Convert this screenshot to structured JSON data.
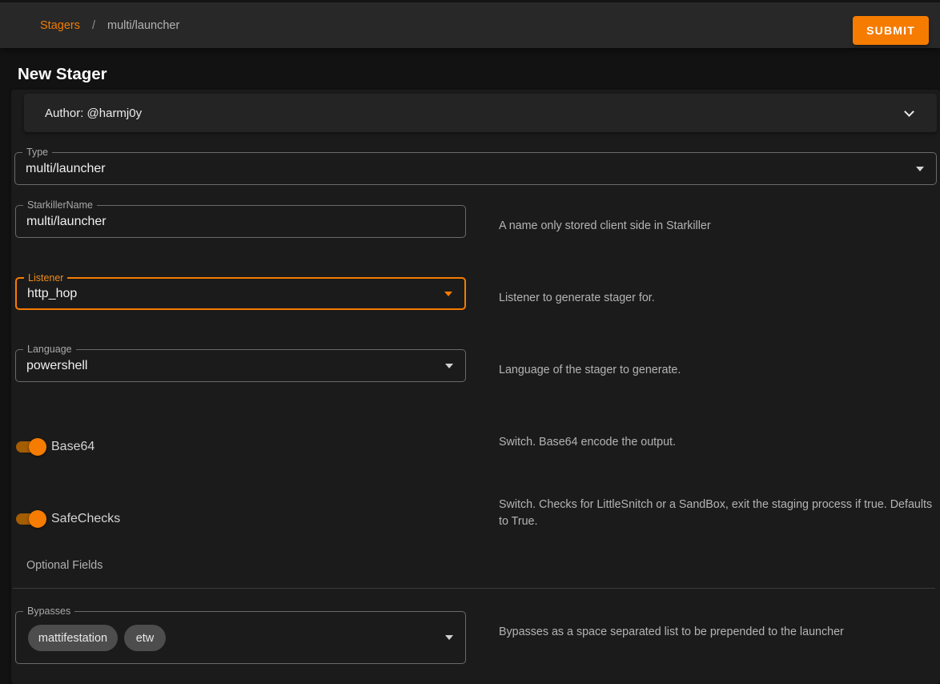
{
  "colors": {
    "accent": "#f07c00",
    "accent_bright": "#f57c00",
    "toolbar_bg": "#282828",
    "page_bg": "#121212",
    "card_bg": "#1b1b1b"
  },
  "toolbar": {
    "breadcrumb": {
      "root": "Stagers",
      "separator": "/",
      "current": "multi/launcher"
    },
    "submit_label": "SUBMIT"
  },
  "page": {
    "title": "New Stager"
  },
  "author_panel": {
    "label": "Author: @harmj0y",
    "icon": "chevron-down-icon"
  },
  "form": {
    "type": {
      "label": "Type",
      "value": "multi/launcher"
    },
    "starkiller_name": {
      "label": "StarkillerName",
      "value": "multi/launcher",
      "description": "A name only stored client side in Starkiller"
    },
    "listener": {
      "label": "Listener",
      "value": "http_hop",
      "description": "Listener to generate stager for.",
      "focused": true
    },
    "language": {
      "label": "Language",
      "value": "powershell",
      "description": "Language of the stager to generate."
    },
    "base64": {
      "label": "Base64",
      "enabled": true,
      "description": "Switch. Base64 encode the output."
    },
    "safechecks": {
      "label": "SafeChecks",
      "enabled": true,
      "description": "Switch. Checks for LittleSnitch or a SandBox, exit the staging process if true. Defaults to True."
    },
    "optional_fields_header": "Optional Fields",
    "bypasses": {
      "label": "Bypasses",
      "chips": [
        "mattifestation",
        "etw"
      ],
      "description": "Bypasses as a space separated list to be prepended to the launcher"
    }
  }
}
